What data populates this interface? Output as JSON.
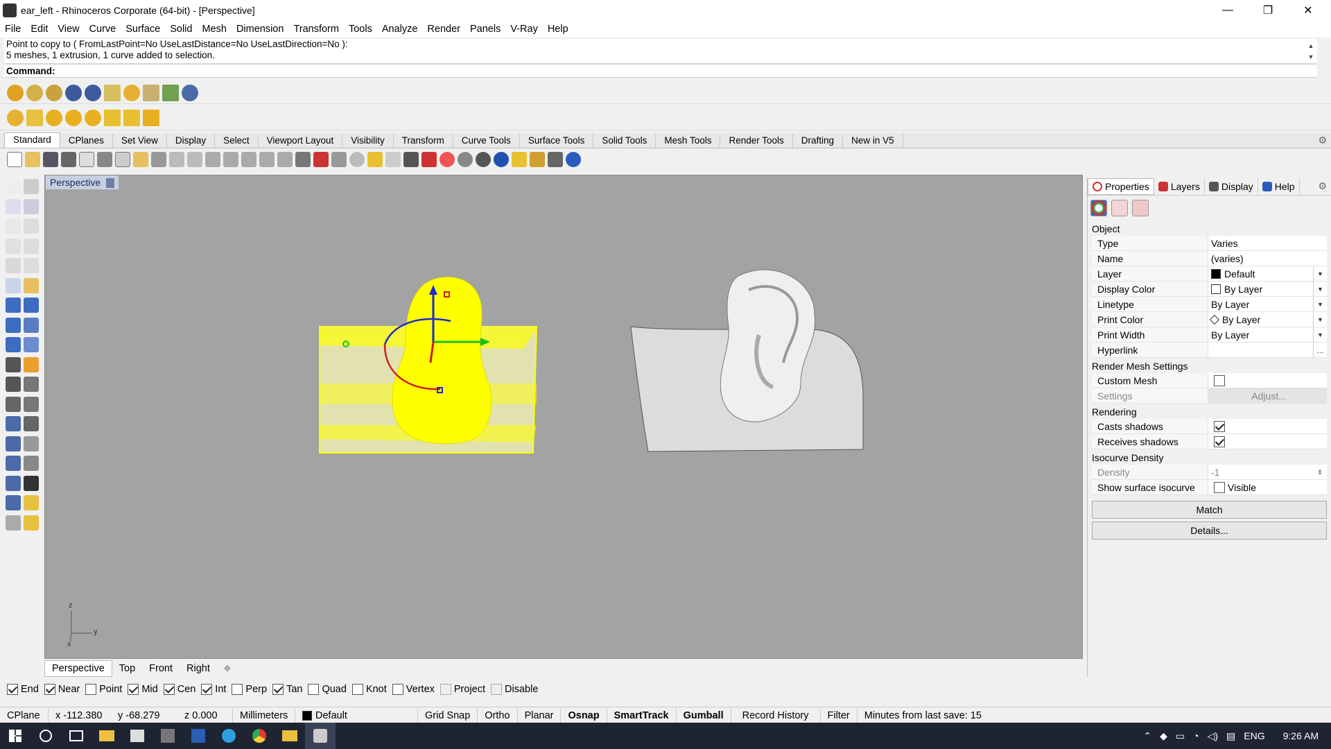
{
  "window": {
    "title": "ear_left - Rhinoceros Corporate (64-bit) - [Perspective]",
    "minimize": "—",
    "maximize": "❐",
    "close": "✕"
  },
  "menu": [
    "File",
    "Edit",
    "View",
    "Curve",
    "Surface",
    "Solid",
    "Mesh",
    "Dimension",
    "Transform",
    "Tools",
    "Analyze",
    "Render",
    "Panels",
    "V-Ray",
    "Help"
  ],
  "command": {
    "history_line1": "Point to copy to ( FromLastPoint=No  UseLastDistance=No  UseLastDirection=No ):",
    "history_line2": "5 meshes, 1 extrusion, 1 curve added to selection.",
    "prompt": "Command:"
  },
  "toolbar_tabs": [
    "Standard",
    "CPlanes",
    "Set View",
    "Display",
    "Select",
    "Viewport Layout",
    "Visibility",
    "Transform",
    "Curve Tools",
    "Surface Tools",
    "Solid Tools",
    "Mesh Tools",
    "Render Tools",
    "Drafting",
    "New in V5"
  ],
  "viewport": {
    "label": "Perspective",
    "axis_z": "z",
    "axis_y": "y",
    "axis_x": "x"
  },
  "viewport_tabs": [
    "Perspective",
    "Top",
    "Front",
    "Right"
  ],
  "osnaps": [
    {
      "label": "End",
      "checked": true
    },
    {
      "label": "Near",
      "checked": true
    },
    {
      "label": "Point",
      "checked": false
    },
    {
      "label": "Mid",
      "checked": true
    },
    {
      "label": "Cen",
      "checked": true
    },
    {
      "label": "Int",
      "checked": true
    },
    {
      "label": "Perp",
      "checked": false
    },
    {
      "label": "Tan",
      "checked": true
    },
    {
      "label": "Quad",
      "checked": false
    },
    {
      "label": "Knot",
      "checked": false
    },
    {
      "label": "Vertex",
      "checked": false
    },
    {
      "label": "Project",
      "checked": false
    },
    {
      "label": "Disable",
      "checked": false
    }
  ],
  "status": {
    "cplane": "CPlane",
    "x": "x -112.380",
    "y": "y -68.279",
    "z": "z 0.000",
    "units": "Millimeters",
    "layer": "Default",
    "grid_snap": "Grid Snap",
    "ortho": "Ortho",
    "planar": "Planar",
    "osnap": "Osnap",
    "smarttrack": "SmartTrack",
    "gumball": "Gumball",
    "record_history": "Record History",
    "filter": "Filter",
    "save": "Minutes from last save: 15"
  },
  "panel": {
    "tabs": [
      "Properties",
      "Layers",
      "Display",
      "Help"
    ],
    "section_object": "Object",
    "rows": {
      "type": {
        "k": "Type",
        "v": "Varies"
      },
      "name": {
        "k": "Name",
        "v": "(varies)"
      },
      "layer": {
        "k": "Layer",
        "v": "Default"
      },
      "display_color": {
        "k": "Display Color",
        "v": "By Layer"
      },
      "linetype": {
        "k": "Linetype",
        "v": "By Layer"
      },
      "print_color": {
        "k": "Print Color",
        "v": "By Layer"
      },
      "print_width": {
        "k": "Print Width",
        "v": "By Layer"
      },
      "hyperlink": {
        "k": "Hyperlink",
        "v": "..."
      }
    },
    "section_mesh": "Render Mesh Settings",
    "custom_mesh": "Custom Mesh",
    "settings": "Settings",
    "adjust": "Adjust...",
    "section_rendering": "Rendering",
    "casts_shadows": "Casts shadows",
    "receives_shadows": "Receives shadows",
    "section_iso": "Isocurve Density",
    "density": "Density",
    "density_val": "-1",
    "show_iso": "Show surface isocurve",
    "visible": "Visible",
    "match": "Match",
    "details": "Details..."
  },
  "taskbar": {
    "lang": "ENG",
    "time": "9:26 AM"
  },
  "colors": {
    "selection": "#ffff00",
    "viewport_bg": "#a3a3a3",
    "accent": "#2d6fd6"
  }
}
